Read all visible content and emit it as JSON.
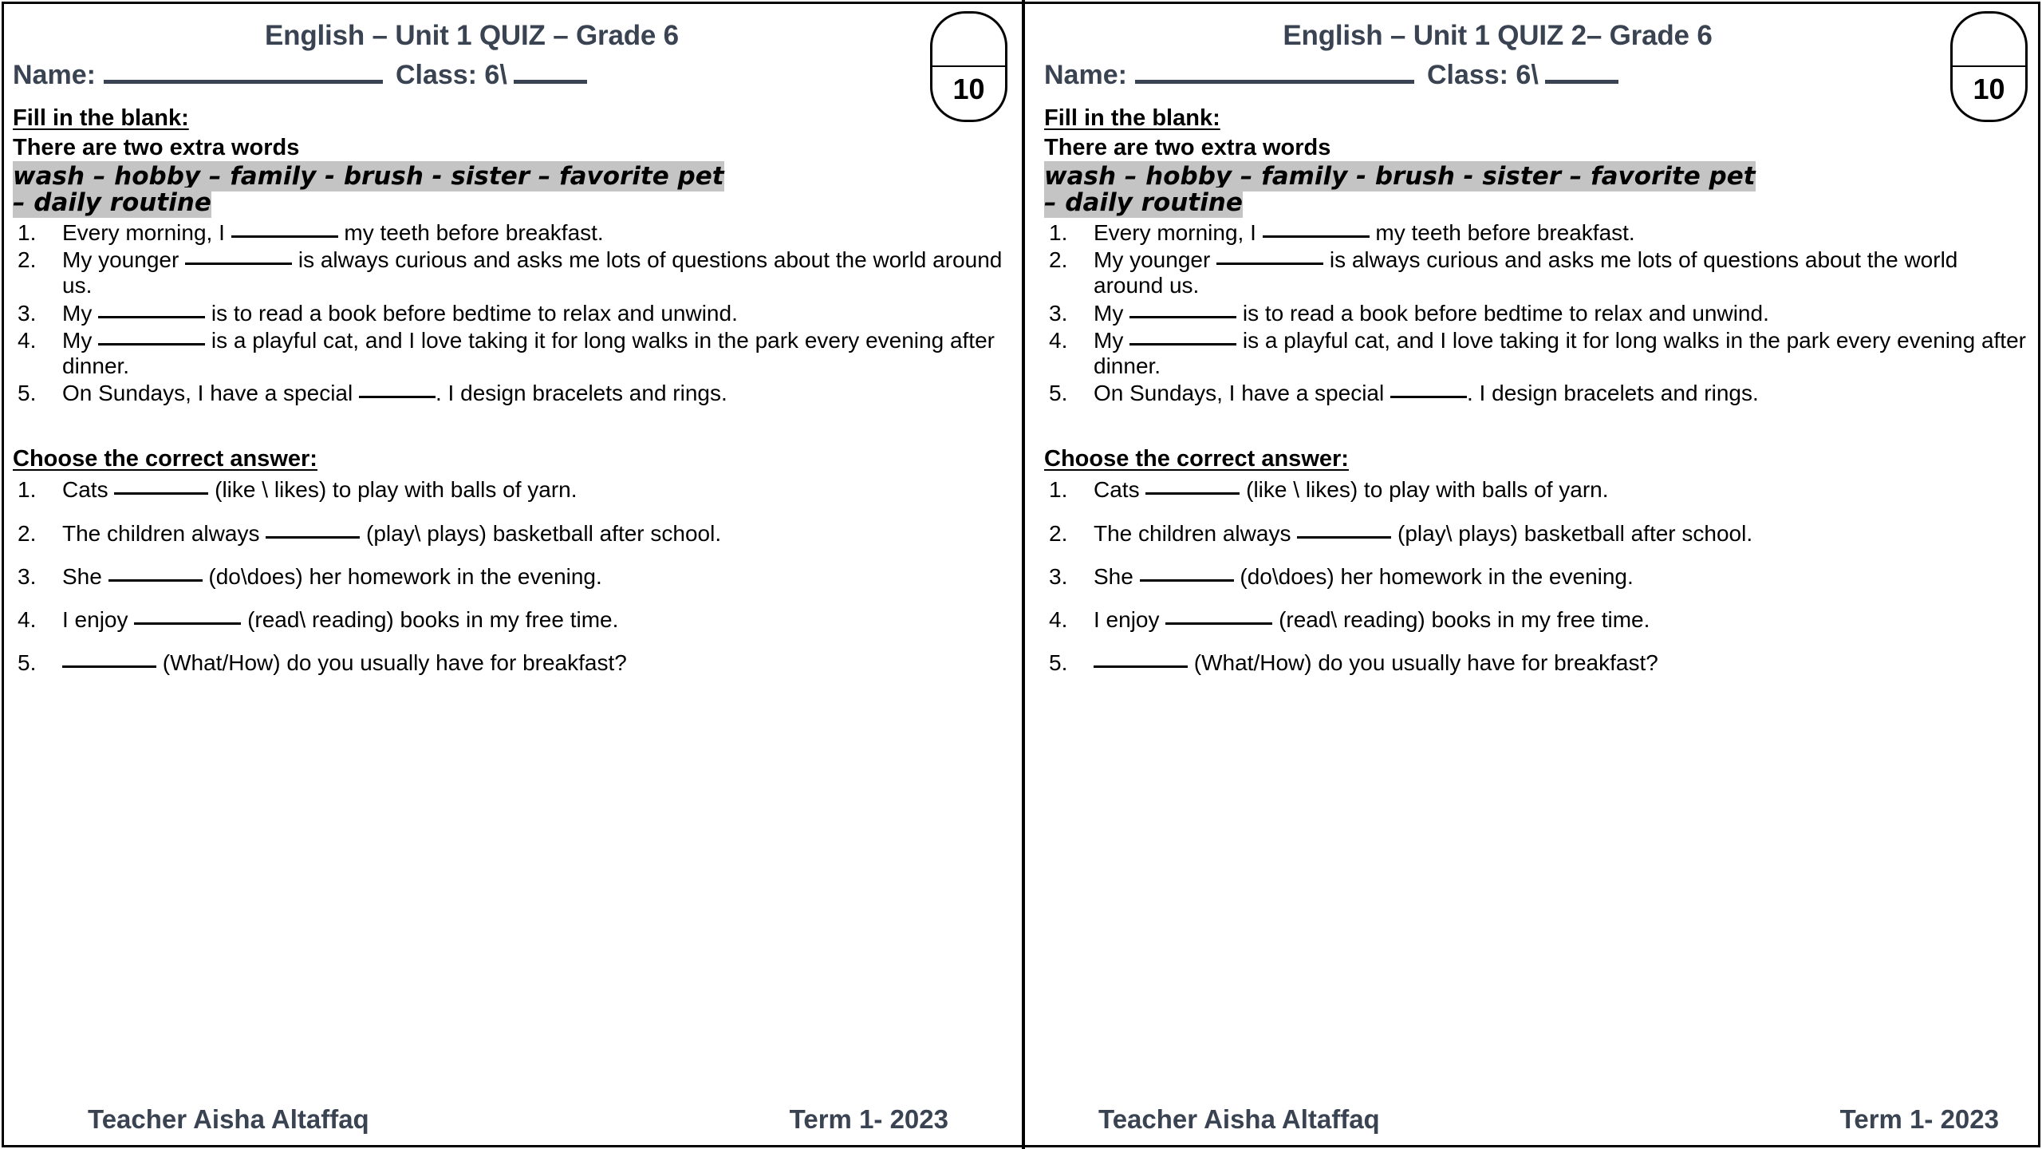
{
  "document": {
    "type": "worksheet",
    "panel_count": 2
  },
  "panels": [
    {
      "header": {
        "title": "English – Unit 1 QUIZ – Grade 6",
        "name_label": "Name:",
        "class_label": "Class: 6\\",
        "score_value": "10"
      },
      "fill_section": {
        "heading": "Fill in the blank:",
        "note": "There are two extra words",
        "word_bank_line1": "wash – hobby – family -  brush - sister – favorite pet",
        "word_bank_line2": "– daily routine",
        "questions": [
          {
            "num": "1.",
            "before": "Every morning, I",
            "blank": "b-md",
            "after": "my teeth before breakfast."
          },
          {
            "num": "2.",
            "before": "My younger",
            "blank": "b-md",
            "after": "is always curious and asks me lots of questions about the world around us."
          },
          {
            "num": "3.",
            "before": "My",
            "blank": "b-md",
            "after": "is to read a book before bedtime to relax and unwind."
          },
          {
            "num": "4.",
            "before": "My",
            "blank": "b-md",
            "after": "is a playful cat, and I love taking it for long walks in the park every evening after dinner."
          },
          {
            "num": "5.",
            "before": "On Sundays, I have a special",
            "blank": "b-xs",
            "after": ". I design bracelets and rings."
          }
        ]
      },
      "choose_section": {
        "heading": "Choose the correct answer:",
        "questions": [
          {
            "num": "1.",
            "before": "Cats",
            "blank": "b-sm",
            "after": "(like \\ likes) to play with balls of yarn."
          },
          {
            "num": "2.",
            "before": "The children always",
            "blank": "b-sm",
            "after": "(play\\ plays) basketball after school."
          },
          {
            "num": "3.",
            "before": "She",
            "blank": "b-sm",
            "after": "(do\\does) her homework in the evening."
          },
          {
            "num": "4.",
            "before": "I enjoy",
            "blank": "b-md",
            "after": "(read\\ reading) books in my free time."
          },
          {
            "num": "5.",
            "before": "",
            "blank": "b-sm",
            "after": "(What/How) do you usually have for breakfast?"
          }
        ]
      },
      "footer": {
        "teacher": "Teacher Aisha Altaffaq",
        "term": "Term 1- 2023"
      }
    },
    {
      "header": {
        "title": "English – Unit 1 QUIZ 2– Grade 6",
        "name_label": "Name:",
        "class_label": "Class: 6\\",
        "score_value": "10"
      },
      "fill_section": {
        "heading": "Fill in the blank:",
        "note": "There are two extra words",
        "word_bank_line1": "wash – hobby – family -  brush - sister – favorite pet",
        "word_bank_line2": "– daily routine",
        "questions": [
          {
            "num": "1.",
            "before": "Every morning, I",
            "blank": "b-md",
            "after": "my teeth before breakfast."
          },
          {
            "num": "2.",
            "before": "My younger",
            "blank": "b-md",
            "after": "is always curious and asks me lots of questions about the world around us."
          },
          {
            "num": "3.",
            "before": "My",
            "blank": "b-md",
            "after": "is to read a book before bedtime to relax and unwind."
          },
          {
            "num": "4.",
            "before": "My",
            "blank": "b-md",
            "after": "is a playful cat, and I love taking it for long walks in the park every evening after dinner."
          },
          {
            "num": "5.",
            "before": "On Sundays, I have a special",
            "blank": "b-xs",
            "after": ". I design bracelets and rings."
          }
        ]
      },
      "choose_section": {
        "heading": "Choose the correct answer:",
        "questions": [
          {
            "num": "1.",
            "before": "Cats",
            "blank": "b-sm",
            "after": "(like \\ likes) to play with balls of yarn."
          },
          {
            "num": "2.",
            "before": "The children always",
            "blank": "b-sm",
            "after": "(play\\ plays) basketball after school."
          },
          {
            "num": "3.",
            "before": "She",
            "blank": "b-sm",
            "after": "(do\\does) her homework in the evening."
          },
          {
            "num": "4.",
            "before": "I enjoy",
            "blank": "b-md",
            "after": "(read\\ reading) books in my free time."
          },
          {
            "num": "5.",
            "before": "",
            "blank": "b-sm",
            "after": "(What/How) do you usually have for breakfast?"
          }
        ]
      },
      "footer": {
        "teacher": "Teacher Aisha Altaffaq",
        "term": "Term 1- 2023"
      }
    }
  ],
  "colors": {
    "title_color": "#3a4352",
    "highlight": "#c4c4c4",
    "body_text": "#000000"
  }
}
